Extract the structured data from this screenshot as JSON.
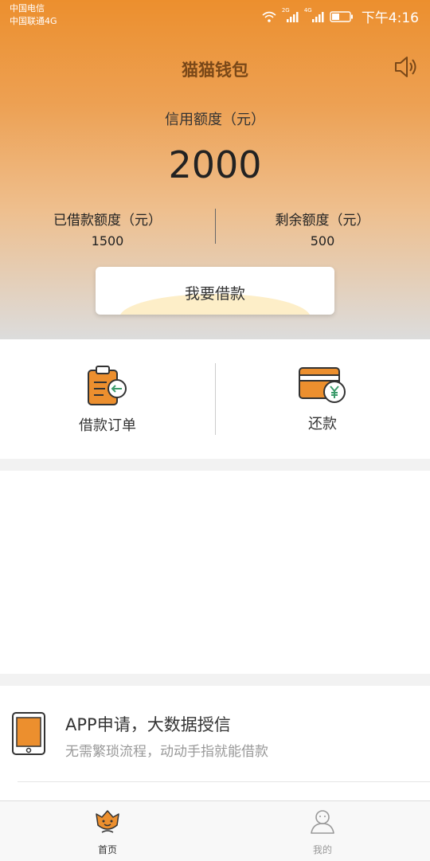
{
  "status_bar": {
    "carrier_1": "中国电信",
    "carrier_2": "中国联通4G",
    "net_1": "2G",
    "net_2": "4G",
    "time": "下午4:16"
  },
  "header": {
    "title": "猫猫钱包"
  },
  "credit": {
    "label": "信用额度（元）",
    "value": "2000",
    "borrowed_label": "已借款额度（元）",
    "borrowed_value": "1500",
    "remaining_label": "剩余额度（元）",
    "remaining_value": "500"
  },
  "borrow_button": {
    "label": "我要借款"
  },
  "actions": [
    {
      "label": "借款订单",
      "icon": "clipboard-return-icon"
    },
    {
      "label": "还款",
      "icon": "card-yen-icon"
    }
  ],
  "promo": {
    "title": "APP申请，大数据授信",
    "subtitle": "无需繁琐流程，动动手指就能借款",
    "icon": "tablet-icon"
  },
  "tabbar": [
    {
      "label": "首页",
      "icon": "tulip-face-icon",
      "active": true
    },
    {
      "label": "我的",
      "icon": "user-icon",
      "active": false
    }
  ],
  "colors": {
    "accent": "#ec8f2e",
    "title_brown": "#7a4818",
    "green": "#3c9b6b"
  }
}
